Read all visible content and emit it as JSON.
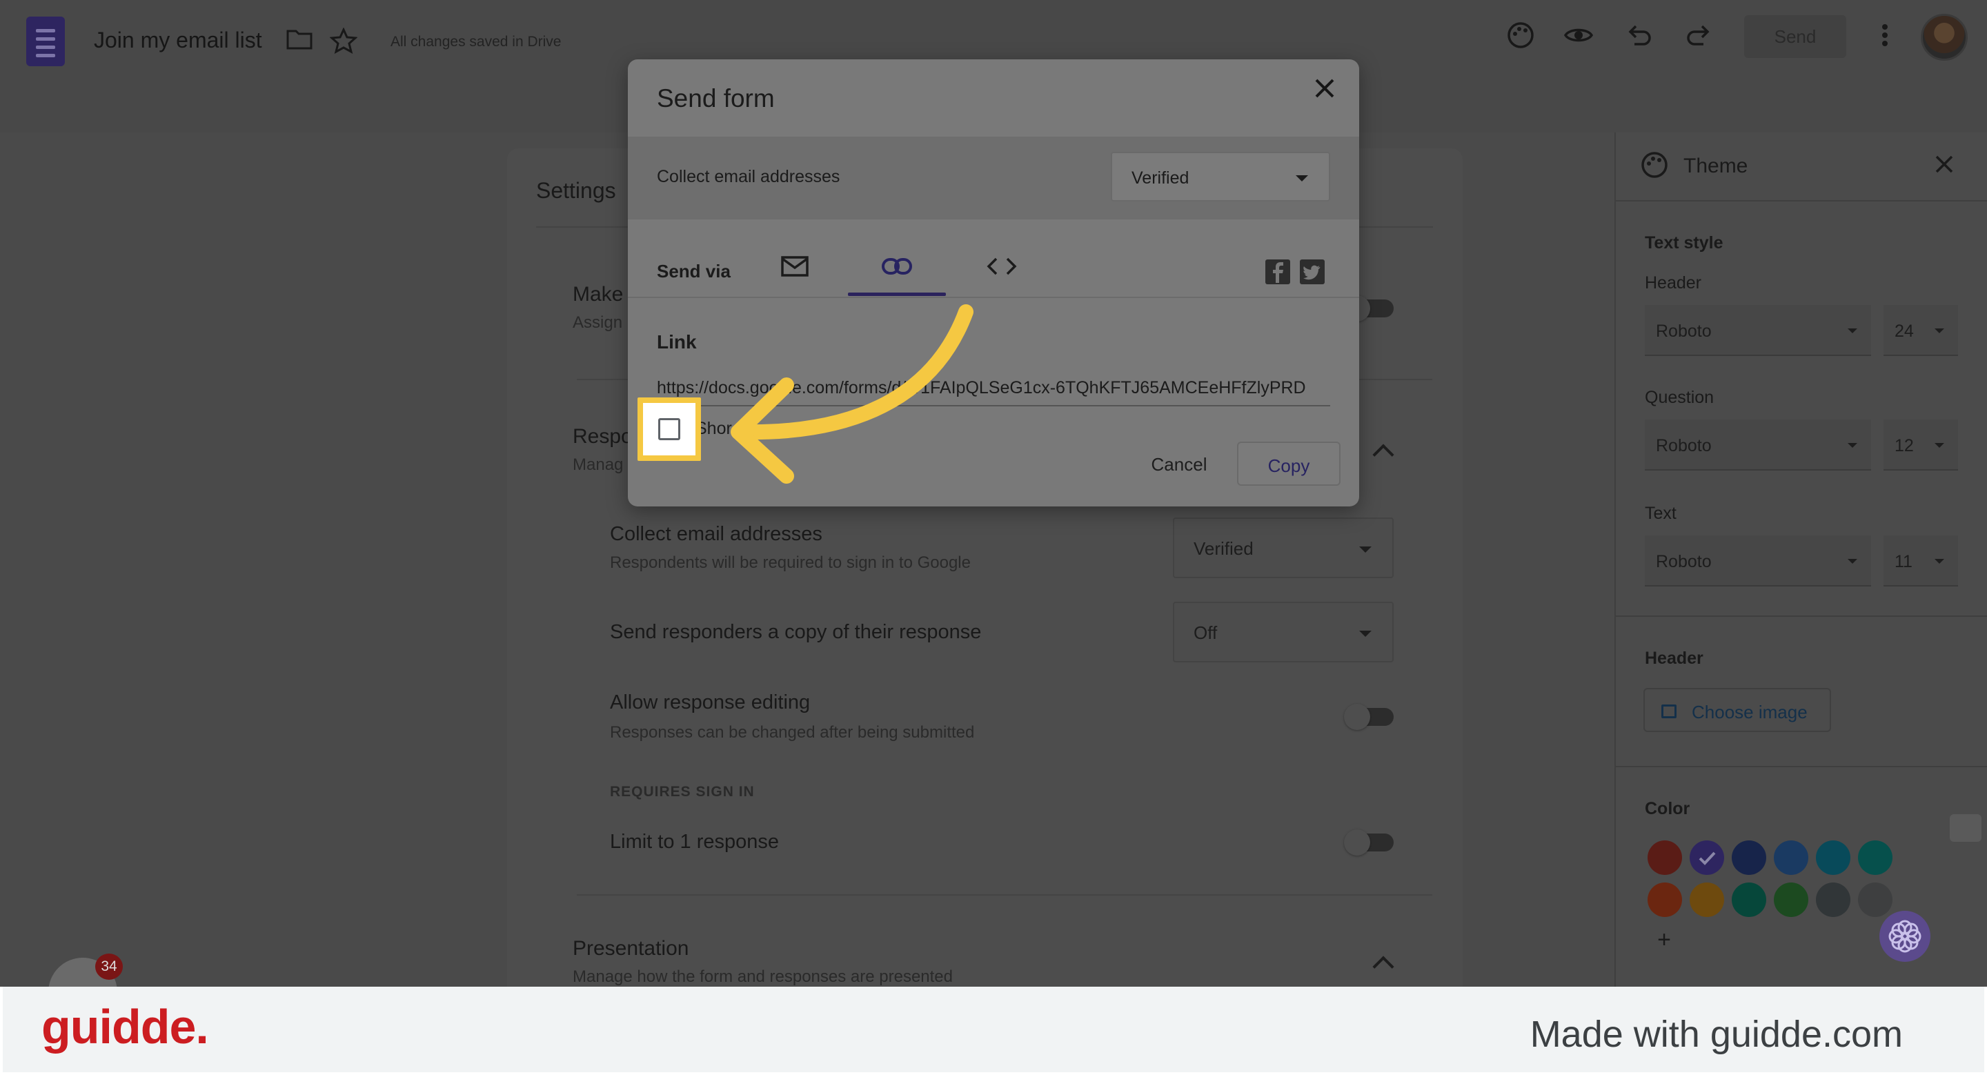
{
  "header": {
    "title": "Join my email list",
    "saved_status": "All changes saved in Drive",
    "send_label": "Send"
  },
  "settings": {
    "title": "Settings",
    "make_partial": "Make",
    "assign_partial": "Assign",
    "responses_partial": "Respo",
    "manage_partial": "Manag",
    "collect_email": {
      "label": "Collect email addresses",
      "sub": "Respondents will be required to sign in to Google",
      "value": "Verified"
    },
    "send_copy": {
      "label": "Send responders a copy of their response",
      "value": "Off"
    },
    "allow_editing": {
      "label": "Allow response editing",
      "sub": "Responses can be changed after being submitted"
    },
    "requires_sign_in": "REQUIRES SIGN IN",
    "limit_one": {
      "label": "Limit to 1 response"
    },
    "presentation": {
      "label": "Presentation",
      "sub": "Manage how the form and responses are presented"
    }
  },
  "theme": {
    "title": "Theme",
    "text_style": "Text style",
    "header_label": "Header",
    "header_font": "Roboto",
    "header_size": "24",
    "question_label": "Question",
    "question_font": "Roboto",
    "question_size": "12",
    "text_label": "Text",
    "text_font": "Roboto",
    "text_size": "11",
    "header_section": "Header",
    "choose_image": "Choose image",
    "color_label": "Color",
    "colors": [
      "#5a1c16",
      "#2e2560",
      "#17244a",
      "#1a3a62",
      "#084a5a",
      "#06504c",
      "#6b2610",
      "#6e4a0e",
      "#06473a",
      "#1c4a20",
      "#313638",
      "#3e3f40"
    ]
  },
  "dialog": {
    "title": "Send form",
    "collect_label": "Collect email addresses",
    "collect_value": "Verified",
    "send_via": "Send via",
    "link_heading": "Link",
    "link_url": "https://docs.google.com/forms/d/e/1FAIpQLSeG1cx-6TQhKFTJ65AMCEeHFfZlyPRD",
    "shorten_partial": "Shor",
    "cancel": "Cancel",
    "copy": "Copy"
  },
  "footer": {
    "brand": "guidde.",
    "made_with": "Made with guidde.com"
  },
  "badge_count": "34"
}
